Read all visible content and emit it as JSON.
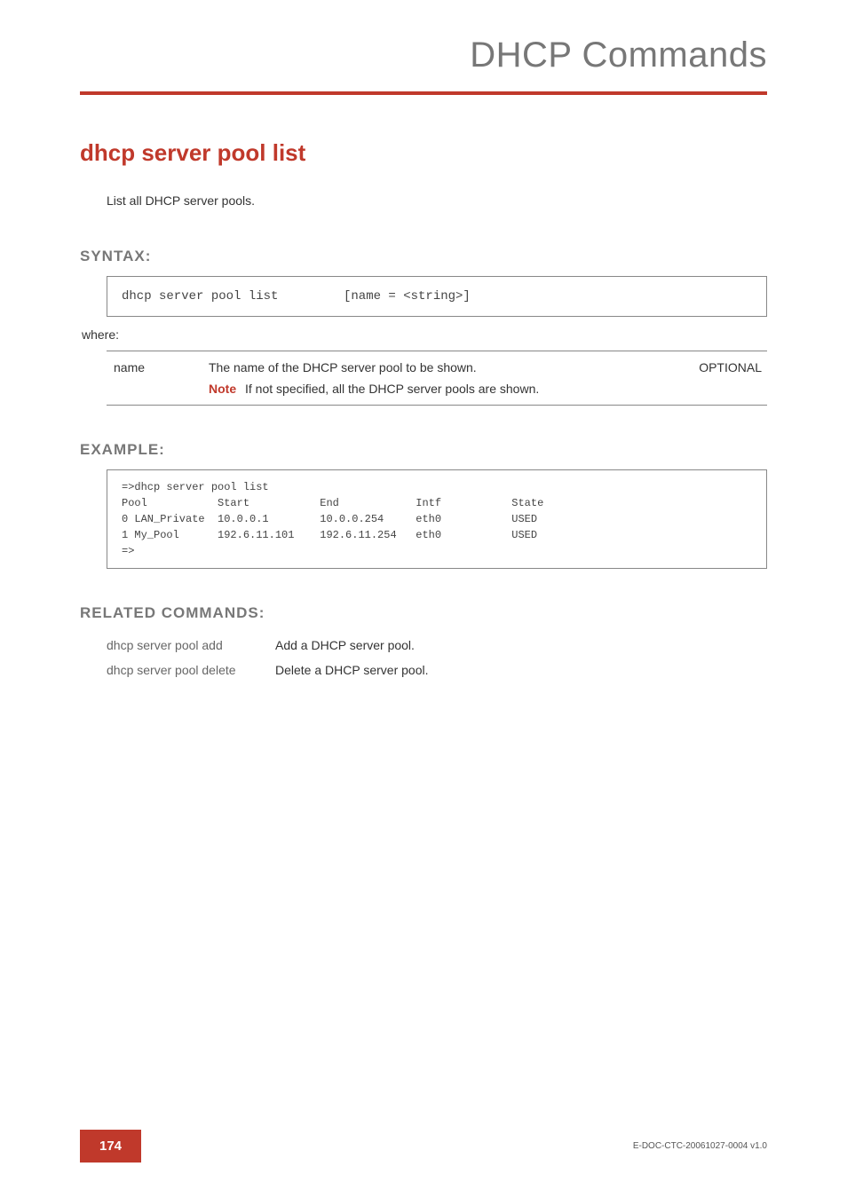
{
  "header": {
    "category": "DHCP Commands"
  },
  "command": {
    "title": "dhcp server pool list",
    "description": "List all DHCP server pools."
  },
  "syntax": {
    "heading": "SYNTAX:",
    "command": "dhcp server pool list",
    "args": "[name = <string>]",
    "where": "where:",
    "params": [
      {
        "name": "name",
        "desc": "The name of the DHCP server pool to be shown.",
        "note_label": "Note",
        "note_text": "If not specified, all the DHCP server pools are shown.",
        "option": "OPTIONAL"
      }
    ]
  },
  "example": {
    "heading": "EXAMPLE:",
    "text": "=>dhcp server pool list\nPool           Start           End            Intf           State\n0 LAN_Private  10.0.0.1        10.0.0.254     eth0           USED\n1 My_Pool      192.6.11.101    192.6.11.254   eth0           USED\n=>"
  },
  "related": {
    "heading": "RELATED COMMANDS:",
    "items": [
      {
        "cmd": "dhcp server pool add",
        "desc": "Add a DHCP server pool."
      },
      {
        "cmd": "dhcp server pool delete",
        "desc": "Delete a DHCP server pool."
      }
    ]
  },
  "footer": {
    "page": "174",
    "docid": "E-DOC-CTC-20061027-0004 v1.0"
  }
}
